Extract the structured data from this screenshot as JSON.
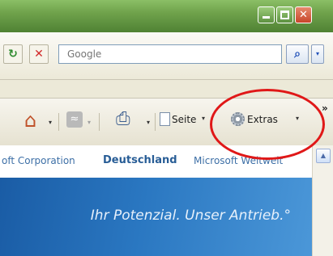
{
  "titlebar": {
    "minimize_glyph": "–",
    "maximize_glyph": "□",
    "close_glyph": "✕"
  },
  "nav": {
    "refresh_glyph": "↻",
    "stop_glyph": "✕",
    "search": {
      "placeholder": "Google",
      "value": ""
    },
    "search_glyph": "⌕",
    "search_menu_glyph": "▾"
  },
  "commandbar": {
    "home_glyph": "⌂",
    "feeds_glyph": "≈",
    "print_glyph": "⎙",
    "page_label": "Seite",
    "extras_label": "Extras",
    "more_glyph": "»",
    "dropdown_glyph": "▾"
  },
  "page": {
    "links": [
      {
        "label": "oft Corporation",
        "bold": false
      },
      {
        "label": "Deutschland",
        "bold": true
      },
      {
        "label": "Microsoft Weltweit",
        "bold": false
      }
    ],
    "slogan": "Ihr Potenzial. Unser Antrieb.°"
  },
  "colors": {
    "highlight": "#e01818",
    "banner": "#1a5ca5",
    "link": "#3d6fa6"
  }
}
